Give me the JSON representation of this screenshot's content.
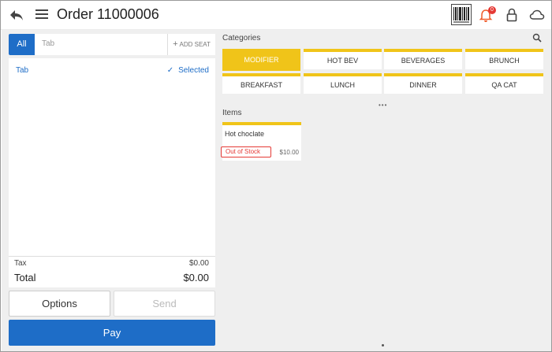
{
  "header": {
    "title": "Order 11000006",
    "notification_count": "0",
    "icons": {
      "back": "back-arrow-icon",
      "menu": "hamburger-menu-icon",
      "barcode": "barcode-icon",
      "bell": "bell-icon",
      "lock": "lock-icon",
      "cloud": "cloud-icon"
    },
    "accent_color": "#f05a28"
  },
  "seat_bar": {
    "all_label": "All",
    "tab_placeholder": "Tab",
    "add_seat_label": "ADD SEAT"
  },
  "order": {
    "tab_label": "Tab",
    "selected_label": "Selected"
  },
  "totals": {
    "tax_label": "Tax",
    "tax_value": "$0.00",
    "total_label": "Total",
    "total_value": "$0.00"
  },
  "buttons": {
    "options": "Options",
    "send": "Send",
    "pay": "Pay"
  },
  "categories": {
    "label": "Categories",
    "items": [
      "MODIFIER",
      "HOT BEV",
      "BEVERAGES",
      "BRUNCH",
      "BREAKFAST",
      "LUNCH",
      "DINNER",
      "QA CAT"
    ],
    "active_index": 0
  },
  "items": {
    "label": "Items",
    "list": [
      {
        "name": "Hot choclate",
        "status": "Out of Stock",
        "price": "$10.00"
      }
    ]
  },
  "colors": {
    "primary": "#1e6dc7",
    "category_accent": "#f0c419",
    "error": "#e53935"
  }
}
